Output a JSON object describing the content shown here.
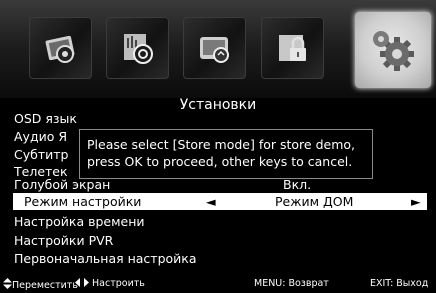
{
  "menu": {
    "title": "Установки",
    "items": [
      {
        "label": "OSD язык"
      },
      {
        "label": "Аудио Я"
      },
      {
        "label": "Субтитр"
      },
      {
        "label": "Телетек"
      },
      {
        "label": "Голубой экран",
        "value": "Вкл."
      },
      {
        "label": "Режим настройки",
        "value": "Режим ДОМ",
        "selected": true
      },
      {
        "label": "Настройка времени"
      },
      {
        "label": "Настройки PVR"
      },
      {
        "label": "Первоначальная настройка"
      }
    ]
  },
  "dialog": {
    "line1": "Please select [Store mode] for store demo,",
    "line2": "press OK to proceed, other keys to cancel."
  },
  "footer": {
    "move": "Переместить",
    "adjust": "Настроить",
    "menu_back": "MENU: Возврат",
    "exit": "EXIT: Выход"
  },
  "arrows": {
    "left": "◄",
    "right": "►"
  },
  "icons": [
    "picture-icon",
    "sound-icon",
    "channel-icon",
    "lock-icon",
    "settings-gear-icon"
  ]
}
